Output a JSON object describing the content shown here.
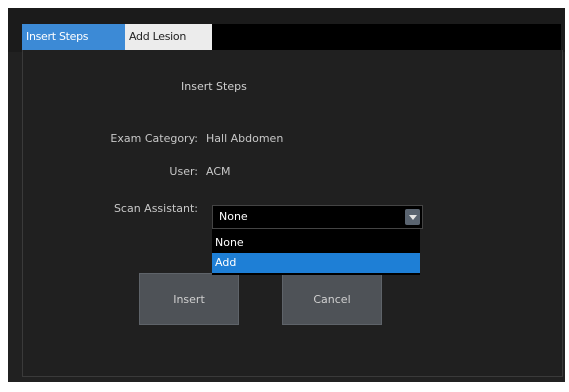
{
  "tabs": [
    {
      "label": "Insert Steps",
      "active": true
    },
    {
      "label": "Add Lesion",
      "active": false
    }
  ],
  "dialog": {
    "title": "Insert Steps",
    "exam_category_label": "Exam Category:",
    "exam_category_value": "Hall Abdomen",
    "user_label": "User:",
    "user_value": "ACM",
    "scan_assistant_label": "Scan Assistant:",
    "scan_assistant_selected": "None",
    "scan_assistant_options": [
      "None",
      "Add"
    ],
    "insert_button": "Insert",
    "cancel_button": "Cancel"
  },
  "colors": {
    "accent": "#3c8ad6",
    "selection": "#1e7fd6",
    "background": "#212121",
    "button": "#4e5257"
  }
}
